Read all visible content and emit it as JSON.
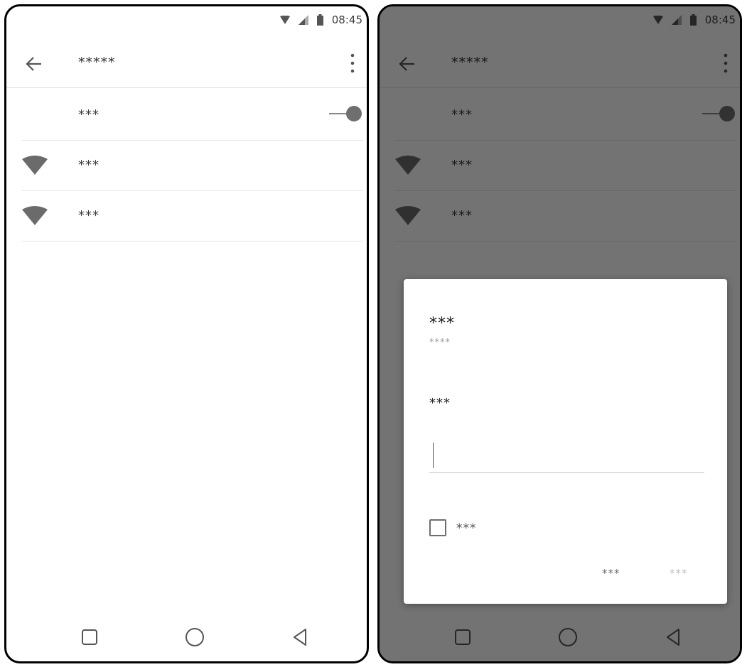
{
  "status_bar": {
    "time": "08:45"
  },
  "app_bar": {
    "title": "*****"
  },
  "settings": {
    "toggle_row": {
      "label": "***"
    },
    "networks": [
      {
        "label": "***",
        "icon": "wifi-icon"
      },
      {
        "label": "***",
        "icon": "wifi-icon"
      }
    ]
  },
  "dialog": {
    "title": "***",
    "subtitle": "****",
    "field_label": "***",
    "input_value": "",
    "checkbox_label": "***",
    "cancel_label": "***",
    "ok_label": "***"
  },
  "colors": {
    "scrim": "#000000",
    "icon_gray": "#6b6b6b",
    "text": "#3d3d3d"
  }
}
